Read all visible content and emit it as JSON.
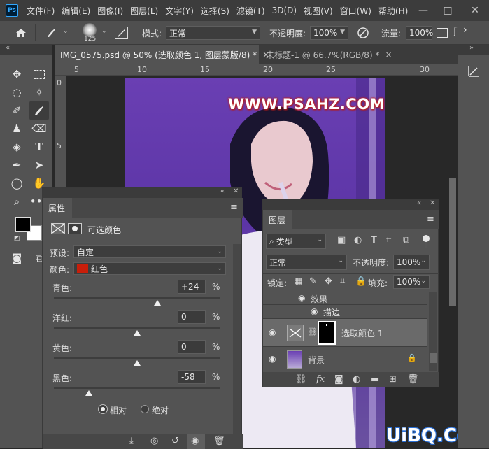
{
  "app": {
    "logo": "Ps"
  },
  "menu": [
    "文件(F)",
    "编辑(E)",
    "图像(I)",
    "图层(L)",
    "文字(Y)",
    "选择(S)",
    "滤镜(T)",
    "3D(D)",
    "视图(V)",
    "窗口(W)",
    "帮助(H)"
  ],
  "window_controls": {
    "minimize": "—",
    "maximize": "□",
    "close": "✕"
  },
  "options": {
    "brush_size": "125",
    "mode_label": "模式:",
    "mode_value": "正常",
    "opacity_label": "不透明度:",
    "opacity_value": "100%",
    "flow_label": "流量:",
    "flow_value": "100%"
  },
  "tabs": [
    {
      "label": "IMG_0575.psd @ 50% (选取颜色 1, 图层蒙版/8) *",
      "close": "×"
    },
    {
      "label": "未标题-1 @ 66.7%(RGB/8) *",
      "close": "×"
    }
  ],
  "ruler_h": [
    "5",
    "10",
    "15",
    "20",
    "25",
    "30"
  ],
  "ruler_v": [
    "0",
    "5"
  ],
  "canvas_text": "WWW.PSAHZ.COM",
  "properties": {
    "tab": "属性",
    "title": "可选颜色",
    "preset_label": "预设:",
    "preset_value": "自定",
    "color_label": "颜色:",
    "color_value": "红色",
    "color_swatch": "#c81e0a",
    "sliders": [
      {
        "label": "青色:",
        "value": "+24",
        "pct": "%",
        "fraction": 0.62
      },
      {
        "label": "洋红:",
        "value": "0",
        "pct": "%",
        "fraction": 0.5
      },
      {
        "label": "黄色:",
        "value": "0",
        "pct": "%",
        "fraction": 0.5
      },
      {
        "label": "黑色:",
        "value": "-58",
        "pct": "%",
        "fraction": 0.21
      }
    ],
    "relative_label": "相对",
    "absolute_label": "绝对"
  },
  "layers": {
    "tab": "图层",
    "filter_value": "类型",
    "blend_value": "正常",
    "opacity_label": "不透明度:",
    "opacity_value": "100%",
    "lock_label": "锁定:",
    "fill_label": "填充:",
    "fill_value": "100%",
    "effects_label": "效果",
    "stroke_label": "描边",
    "selective_layer_name": "选取颜色 1",
    "background_layer_name": "背景"
  },
  "watermark": "UiBQ.CoM"
}
